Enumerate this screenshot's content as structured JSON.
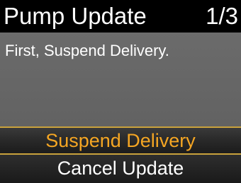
{
  "header": {
    "title": "Pump Update",
    "page_indicator": "1/3"
  },
  "body": {
    "message": "First, Suspend Delivery."
  },
  "options": [
    {
      "label": "Suspend Delivery",
      "selected": true
    },
    {
      "label": "Cancel Update",
      "selected": false
    }
  ],
  "colors": {
    "selected_text": "#f5a623",
    "selected_border": "#c9a23c",
    "panel_gray": "#666666"
  }
}
